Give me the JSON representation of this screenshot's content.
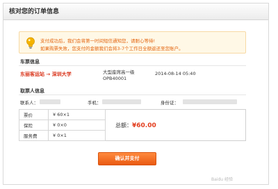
{
  "dialog": {
    "title": "核对您的订单信息"
  },
  "notice": {
    "line1": "支付成功后，我们会将第一时间短信通知您，请耐心等待!",
    "line2": "如果购票失败，您支付的金额我们会将3-7个工作日全额返还至您账户。"
  },
  "ticket_section": {
    "title": "车票信息",
    "route": "东丽客运站 → 深圳大学",
    "bus_type": "大型座席高一级",
    "bus_code": "OPB40001",
    "departure": "2014-08-14 05:40"
  },
  "passenger_section": {
    "title": "取票人信息",
    "contact_label": "联系人：",
    "phone_label": "手机：",
    "id_label": "身份证："
  },
  "fees": {
    "rows": [
      {
        "name": "票价",
        "value": "¥ 60×1"
      },
      {
        "name": "保险",
        "value": "¥ 0×0"
      },
      {
        "name": "服务费",
        "value": "¥ 0×1"
      }
    ],
    "total_label": "总额：",
    "total_value": "¥60.00"
  },
  "actions": {
    "confirm_label": "确认并支付"
  },
  "watermark": "Baidu 经验"
}
